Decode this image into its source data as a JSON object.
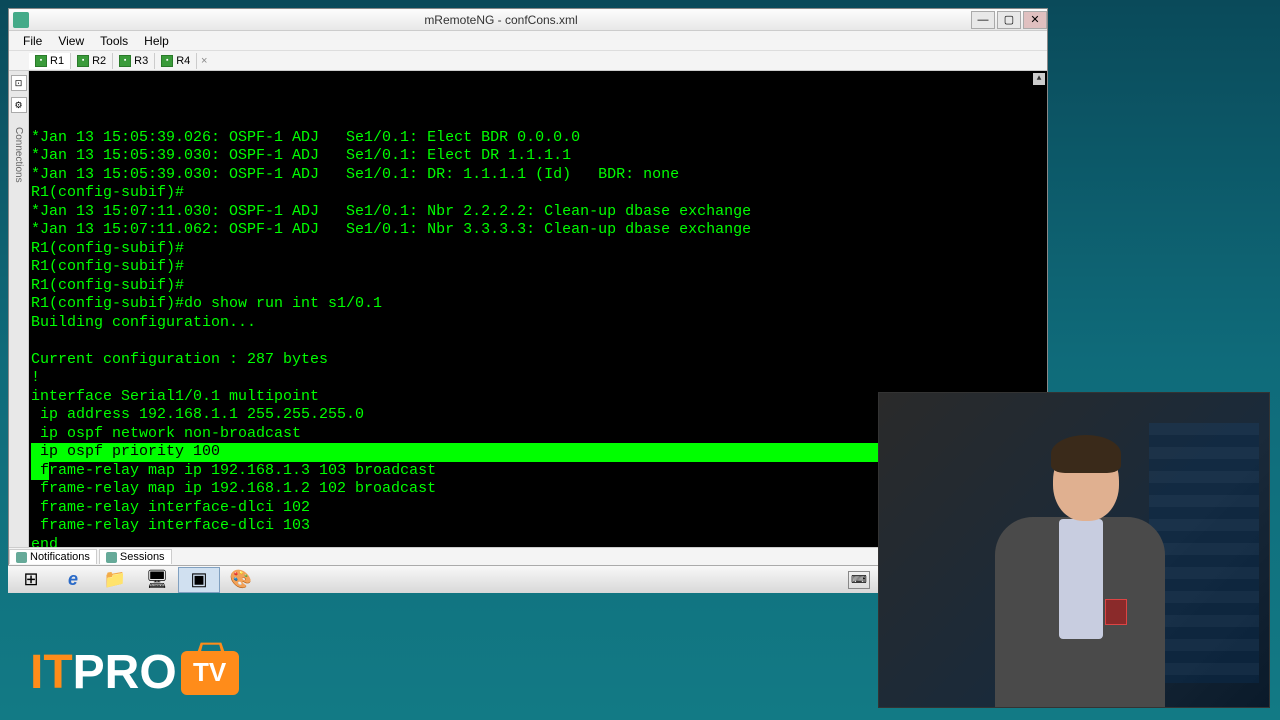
{
  "window": {
    "title": "mRemoteNG - confCons.xml",
    "min": "—",
    "max": "▢",
    "close": "✕"
  },
  "menu": [
    "File",
    "View",
    "Tools",
    "Help"
  ],
  "tabs": [
    {
      "label": "R1",
      "active": true
    },
    {
      "label": "R2",
      "active": false
    },
    {
      "label": "R3",
      "active": false
    },
    {
      "label": "R4",
      "active": false
    }
  ],
  "rail_label": "Connections",
  "terminal": {
    "lines": [
      "*Jan 13 15:05:39.026: OSPF-1 ADJ   Se1/0.1: Elect BDR 0.0.0.0",
      "*Jan 13 15:05:39.030: OSPF-1 ADJ   Se1/0.1: Elect DR 1.1.1.1",
      "*Jan 13 15:05:39.030: OSPF-1 ADJ   Se1/0.1: DR: 1.1.1.1 (Id)   BDR: none",
      "R1(config-subif)#",
      "*Jan 13 15:07:11.030: OSPF-1 ADJ   Se1/0.1: Nbr 2.2.2.2: Clean-up dbase exchange",
      "*Jan 13 15:07:11.062: OSPF-1 ADJ   Se1/0.1: Nbr 3.3.3.3: Clean-up dbase exchange",
      "R1(config-subif)#",
      "R1(config-subif)#",
      "R1(config-subif)#",
      "R1(config-subif)#do show run int s1/0.1",
      "Building configuration...",
      "",
      "Current configuration : 287 bytes",
      "!",
      "interface Serial1/0.1 multipoint",
      " ip address 192.168.1.1 255.255.255.0",
      " ip ospf network non-broadcast"
    ],
    "highlight_a": " ip ospf priority 100",
    "highlight_b_prefix": " f",
    "highlight_b_rest": "rame-relay map ip 192.168.1.3 103 broadcast",
    "after": [
      " frame-relay map ip 192.168.1.2 102 broadcast",
      " frame-relay interface-dlci 102",
      " frame-relay interface-dlci 103",
      "end",
      ""
    ],
    "prompt": "R1(config-subif)#"
  },
  "bottom_tabs": [
    {
      "label": "Notifications"
    },
    {
      "label": "Sessions"
    }
  ],
  "taskbar": {
    "start": "⊞",
    "ie": "e",
    "explorer": "📁",
    "putty": "🖥",
    "mremote": "▣",
    "paint": "🎨",
    "keyboard": "⌨"
  },
  "logo": {
    "it": "IT",
    "pro": "PRO",
    "tv": "TV"
  }
}
